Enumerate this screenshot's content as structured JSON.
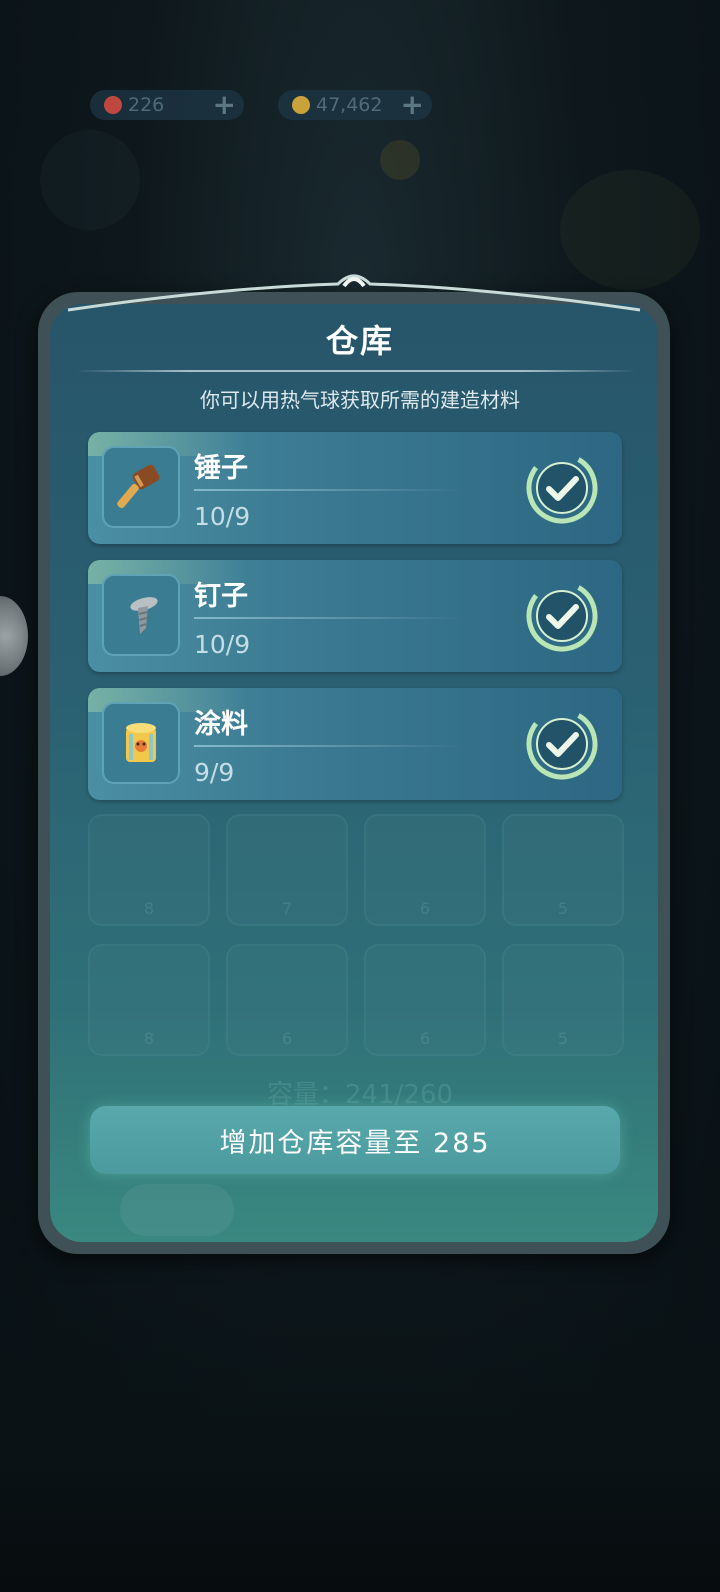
{
  "currency": {
    "gems": {
      "value": "226",
      "icon": "gem-icon",
      "color": "#c0473f"
    },
    "coins": {
      "value": "47,462",
      "icon": "coin-icon",
      "color": "#c9a23a"
    }
  },
  "panel": {
    "title": "仓库",
    "subtitle": "你可以用热气球获取所需的建造材料",
    "items": [
      {
        "name": "锤子",
        "count": "10/9",
        "icon": "hammer-icon"
      },
      {
        "name": "钉子",
        "count": "10/9",
        "icon": "nail-icon"
      },
      {
        "name": "涂料",
        "count": "9/9",
        "icon": "paint-bucket-icon"
      }
    ],
    "ghost_slots": [
      "8",
      "7",
      "6",
      "5",
      "8",
      "6",
      "6",
      "5"
    ],
    "capacity_label": "容量：241/260",
    "upgrade_button": "增加仓库容量至 285"
  },
  "colors": {
    "panel_frame": "#3f5156",
    "item_row": "#3b7a92",
    "check_ring": "#b9e6b4",
    "button": "#58a8ac"
  }
}
